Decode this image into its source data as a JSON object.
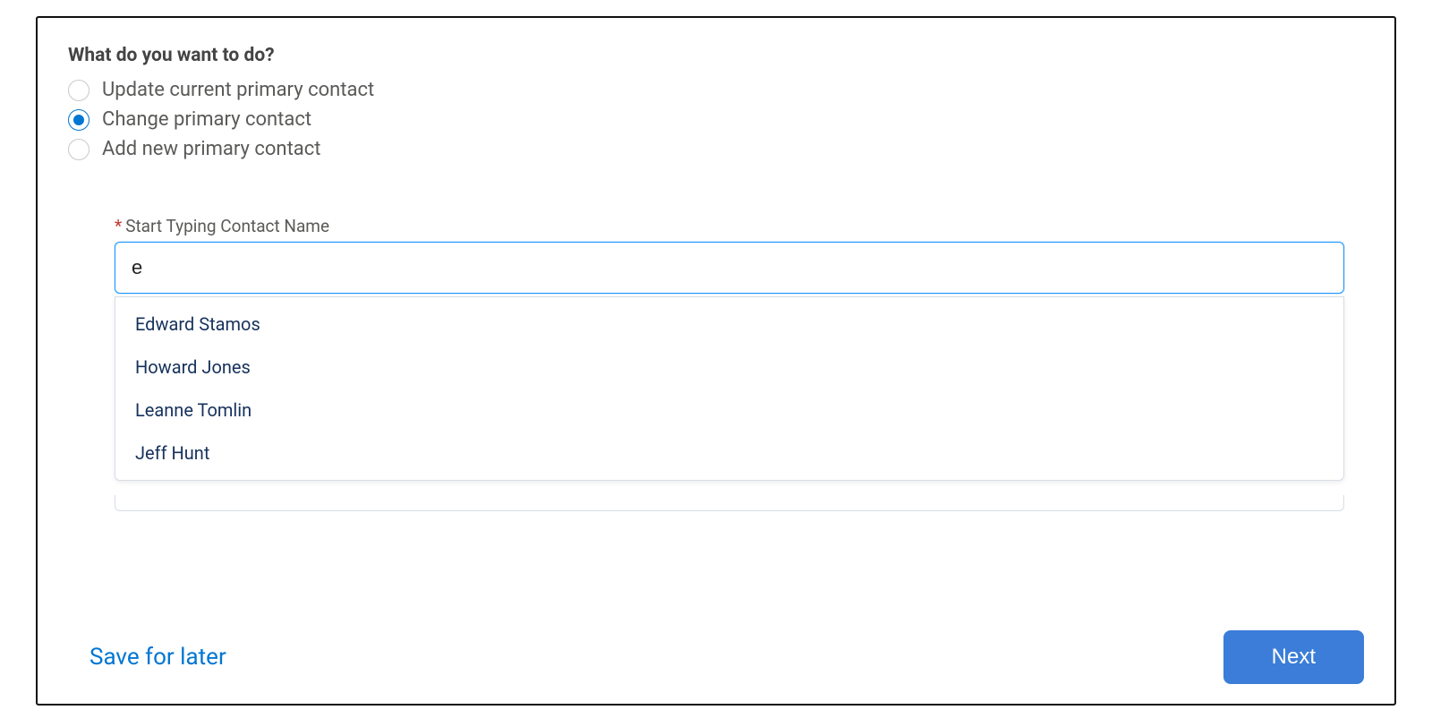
{
  "question": "What do you want to do?",
  "options": [
    {
      "label": "Update current primary contact",
      "selected": false
    },
    {
      "label": "Change primary contact",
      "selected": true
    },
    {
      "label": "Add new primary contact",
      "selected": false
    }
  ],
  "lookup": {
    "required_mark": "*",
    "label": "Start Typing Contact Name",
    "value": "e",
    "results": [
      "Edward Stamos",
      "Howard Jones",
      "Leanne Tomlin",
      "Jeff Hunt"
    ]
  },
  "footer": {
    "save_link": "Save for later",
    "next_label": "Next"
  }
}
